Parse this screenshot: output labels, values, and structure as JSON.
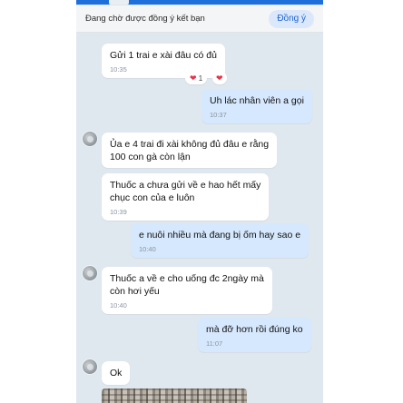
{
  "banner": {
    "text": "Đang chờ được đồng ý kết bạn",
    "accept_label": "Đồng ý"
  },
  "messages": [
    {
      "side": "them",
      "text": "Gửi 1 trai e xài đâu có đủ",
      "time": "10:35"
    },
    {
      "side": "me",
      "text": "Uh lác nhân viên a gọi",
      "time": "10:37"
    },
    {
      "side": "them",
      "lines": [
        "Ủa e 4 trai đi xài không đủ đâu e rằng",
        "100 con gà còn lận"
      ]
    },
    {
      "side": "them",
      "lines": [
        "Thuốc a chưa gửi về e hao hết mấy",
        "chục con của e luôn"
      ],
      "time": "10:39"
    },
    {
      "side": "me",
      "text": "e nuôi nhiều mà đang bị ốm hay sao e",
      "time": "10:40"
    },
    {
      "side": "them",
      "lines": [
        "Thuốc a về e cho uống đc 2ngày mà",
        "còn hơi yếu"
      ],
      "time": "10:40"
    },
    {
      "side": "me",
      "text": "mà đỡ hơn rồi đúng ko",
      "time": "11:07"
    },
    {
      "side": "them",
      "text": "Ok"
    }
  ],
  "reactions": {
    "first": {
      "icon": "heart-icon",
      "count": "1"
    },
    "second": {
      "icon": "heart-icon"
    }
  },
  "colors": {
    "accent": "#1d63d6",
    "my_bubble": "#d6e8fd",
    "their_bubble": "#ffffff",
    "chat_bg": "#dfe7ef"
  }
}
